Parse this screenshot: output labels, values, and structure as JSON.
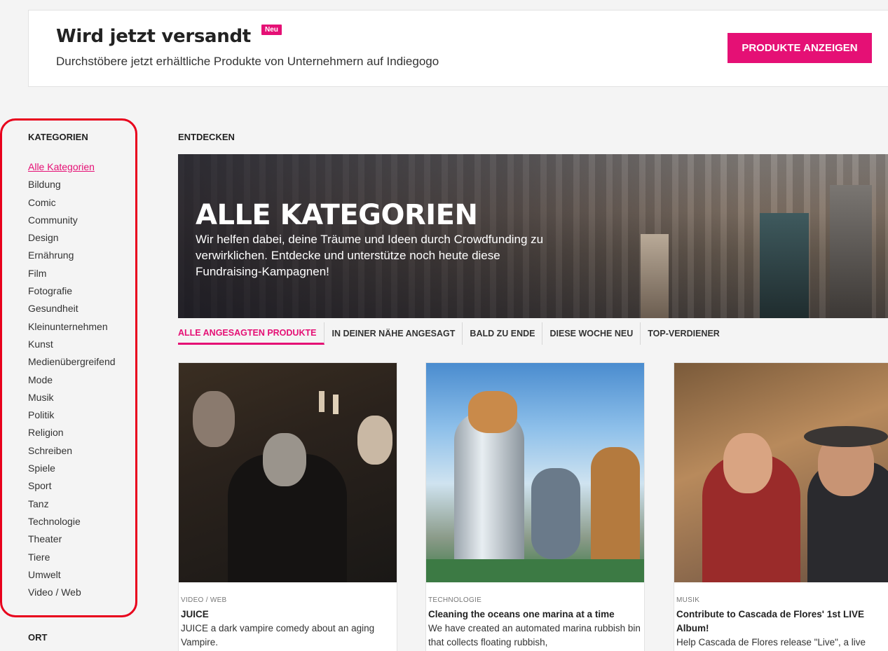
{
  "banner": {
    "title": "Wird jetzt versandt",
    "badge": "Neu",
    "subtitle": "Durchstöbere jetzt erhältliche Produkte von Unternehmern auf Indiegogo",
    "cta_label": "PRODUKTE ANZEIGEN"
  },
  "sidebar": {
    "heading": "KATEGORIEN",
    "categories": [
      "Alle Kategorien",
      "Bildung",
      "Comic",
      "Community",
      "Design",
      "Ernährung",
      "Film",
      "Fotografie",
      "Gesundheit",
      "Kleinunternehmen",
      "Kunst",
      "Medienübergreifend",
      "Mode",
      "Musik",
      "Politik",
      "Religion",
      "Schreiben",
      "Spiele",
      "Sport",
      "Tanz",
      "Technologie",
      "Theater",
      "Tiere",
      "Umwelt",
      "Video / Web"
    ],
    "active_category": "Alle Kategorien",
    "location_heading": "ORT"
  },
  "main": {
    "heading": "ENTDECKEN",
    "hero": {
      "title": "ALLE KATEGORIEN",
      "text": "Wir helfen dabei, deine Träume und Ideen durch Crowdfunding zu verwirklichen. Entdecke und unterstütze noch heute diese Fundraising-Kampagnen!"
    },
    "tabs": [
      "ALLE ANGESAGTEN PRODUKTE",
      "IN DEINER NÄHE ANGESAGT",
      "BALD ZU ENDE",
      "DIESE WOCHE NEU",
      "TOP-VERDIENER"
    ],
    "cards": [
      {
        "category": "VIDEO / WEB",
        "title": "JUICE",
        "description": "JUICE a dark vampire comedy about an aging Vampire."
      },
      {
        "category": "TECHNOLOGIE",
        "title": "Cleaning the oceans one marina at a time",
        "description": "We have created an automated marina rubbish bin that collects floating rubbish,"
      },
      {
        "category": "MUSIK",
        "title": "Contribute to Cascada de Flores' 1st LIVE Album!",
        "description": "Help Cascada de Flores release \"Live\", a live"
      }
    ]
  },
  "colors": {
    "accent": "#e51075",
    "highlight_outline": "#e8001c",
    "background": "#f4f4f4"
  }
}
